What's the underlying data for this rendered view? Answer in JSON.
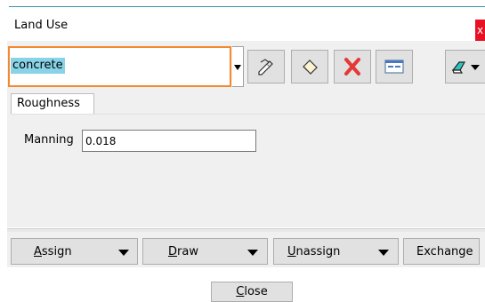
{
  "window": {
    "title": "Land Use",
    "close_glyph": "x"
  },
  "toolbar": {
    "combo_value": "concrete",
    "buttons": [
      {
        "icon": "edit-icon"
      },
      {
        "icon": "eraser-icon"
      },
      {
        "icon": "delete-icon"
      },
      {
        "icon": "properties-icon"
      },
      {
        "icon": "draw-tool-icon"
      }
    ],
    "accent_color": "#f4892e",
    "delete_color": "#e53935"
  },
  "tabs": [
    {
      "label": "Roughness"
    }
  ],
  "roughness": {
    "manning_label": "Manning",
    "manning_value": "0.018"
  },
  "actions": {
    "assign": {
      "key": "A",
      "rest": "ssign"
    },
    "draw": {
      "key": "D",
      "rest": "raw"
    },
    "unassign": {
      "key": "U",
      "rest": "nassign"
    },
    "exchange": {
      "label": "Exchange"
    }
  },
  "footer": {
    "close_key": "C",
    "close_rest": "lose"
  }
}
